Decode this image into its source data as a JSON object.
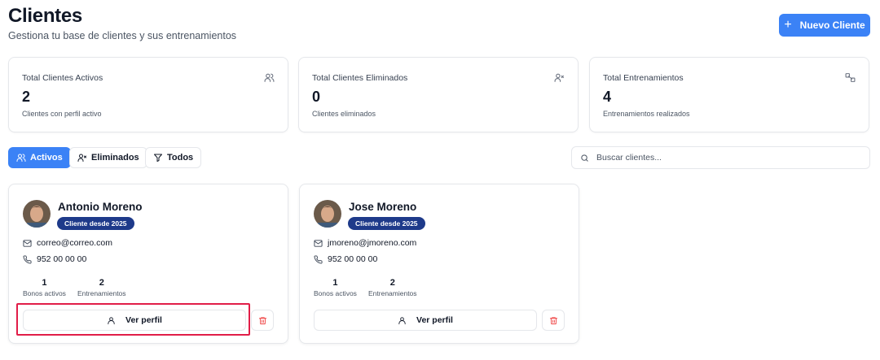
{
  "header": {
    "title": "Clientes",
    "subtitle": "Gestiona tu base de clientes y sus entrenamientos",
    "new_button_label": "Nuevo Cliente",
    "new_button_icon": "plus-icon"
  },
  "stats": [
    {
      "label": "Total Clientes Activos",
      "value": "2",
      "description": "Clientes con perfil activo",
      "icon": "users-icon"
    },
    {
      "label": "Total Clientes Eliminados",
      "value": "0",
      "description": "Clientes eliminados",
      "icon": "user-x-icon"
    },
    {
      "label": "Total Entrenamientos",
      "value": "4",
      "description": "Entrenamientos realizados",
      "icon": "dumbbell-icon"
    }
  ],
  "filters": [
    {
      "label": "Activos",
      "icon": "users-icon",
      "active": true
    },
    {
      "label": "Eliminados",
      "icon": "user-x-icon",
      "active": false
    },
    {
      "label": "Todos",
      "icon": "filter-icon",
      "active": false
    }
  ],
  "search": {
    "placeholder": "Buscar clientes..."
  },
  "clients": [
    {
      "name": "Antonio Moreno",
      "badge": "Cliente desde 2025",
      "email": "correo@correo.com",
      "phone": "952 00 00 00",
      "bonos_value": "1",
      "bonos_label": "Bonos activos",
      "trainings_value": "2",
      "trainings_label": "Entrenamientos",
      "profile_button": "Ver perfil"
    },
    {
      "name": "Jose Moreno",
      "badge": "Cliente desde 2025",
      "email": "jmoreno@jmoreno.com",
      "phone": "952 00 00 00",
      "bonos_value": "1",
      "bonos_label": "Bonos activos",
      "trainings_value": "2",
      "trainings_label": "Entrenamientos",
      "profile_button": "Ver perfil"
    }
  ],
  "colors": {
    "primary": "#3b82f6",
    "badge": "#1e3a8a",
    "danger": "#ef4444",
    "highlight": "#e11d48"
  }
}
